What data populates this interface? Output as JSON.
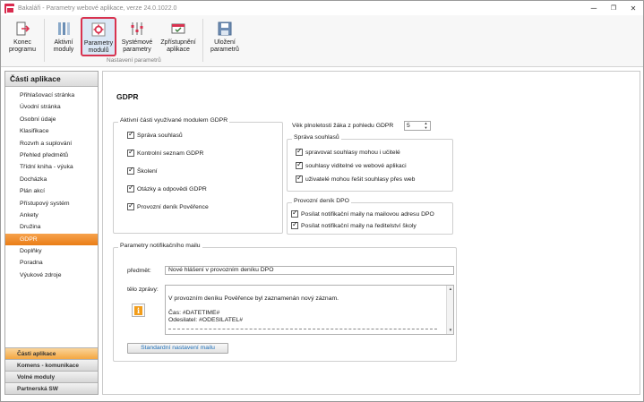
{
  "window": {
    "title": "Bakaláři - Parametry webové aplikace, verze 24.0.1022.0",
    "minimize": "─",
    "restore": "❐",
    "close": "✕"
  },
  "ribbon": {
    "buttons": [
      {
        "id": "konec",
        "label": "Konec\nprogramu"
      },
      {
        "id": "aktivni",
        "label": "Aktivní\nmoduly"
      },
      {
        "id": "parametry",
        "label": "Parametry\nmodulů"
      },
      {
        "id": "systemove",
        "label": "Systémové\nparametry"
      },
      {
        "id": "zpristupneni",
        "label": "Zpřístupnění\naplikace"
      },
      {
        "id": "ulozeni",
        "label": "Uložení\nparametrů"
      }
    ],
    "group_label": "Nastavení parametrů"
  },
  "sidebar": {
    "header": "Části aplikace",
    "items": [
      "Přihlašovací stránka",
      "Úvodní stránka",
      "Osobní údaje",
      "Klasifikace",
      "Rozvrh a suplování",
      "Přehled předmětů",
      "Třídní kniha - výuka",
      "Docházka",
      "Plán akcí",
      "Přístupový systém",
      "Ankety",
      "Družina",
      "GDPR",
      "Doplňky",
      "Poradna",
      "Výukové zdroje"
    ],
    "selected_index": 12,
    "bottom": [
      "Části aplikace",
      "Komens - komunikace",
      "Volné moduly",
      "Partnerská SW"
    ]
  },
  "main": {
    "title": "GDPR",
    "active_parts": {
      "legend": "Aktivní části využívané modulem GDPR",
      "items": [
        {
          "label": "Správa souhlasů",
          "checked": true
        },
        {
          "label": "Kontrolní seznam GDPR",
          "checked": true
        },
        {
          "label": "Školení",
          "checked": true
        },
        {
          "label": "Otázky a odpovědi GDPR",
          "checked": true
        },
        {
          "label": "Provozní deník Pověřence",
          "checked": true
        }
      ]
    },
    "age": {
      "label": "Věk plnoletosti žáka z pohledu GDPR",
      "value": "5"
    },
    "consents": {
      "legend": "Správa souhlasů",
      "items": [
        {
          "label": "spravovat souhlasy mohou i učitelé",
          "checked": true
        },
        {
          "label": "souhlasy viditelné ve webové aplikaci",
          "checked": true
        },
        {
          "label": "uživatelé mohou řešit souhlasy přes web",
          "checked": true
        }
      ]
    },
    "dpo_log": {
      "legend": "Provozní deník DPO",
      "items": [
        {
          "label": "Posílat notifikační maily na mailovou adresu DPO",
          "checked": true
        },
        {
          "label": "Posílat notifikační maily na ředitelství školy",
          "checked": true
        }
      ]
    },
    "mail": {
      "legend": "Parametry notifikačního mailu",
      "subject_label": "předmět:",
      "subject_value": "Nové hlášení v provozním deníku DPO",
      "body_label": "tělo zprávy:",
      "body_text": "V provozním deníku Pověřence byl zaznamenán nový záznam.\n\nČas: #DATETIME#\nOdesilatel: #ODESILATEL#",
      "default_button": "Standardní nastavení mailu"
    }
  },
  "colors": {
    "accent": "#ea7d16",
    "active_border": "#d83350",
    "link": "#1e6fb8"
  }
}
